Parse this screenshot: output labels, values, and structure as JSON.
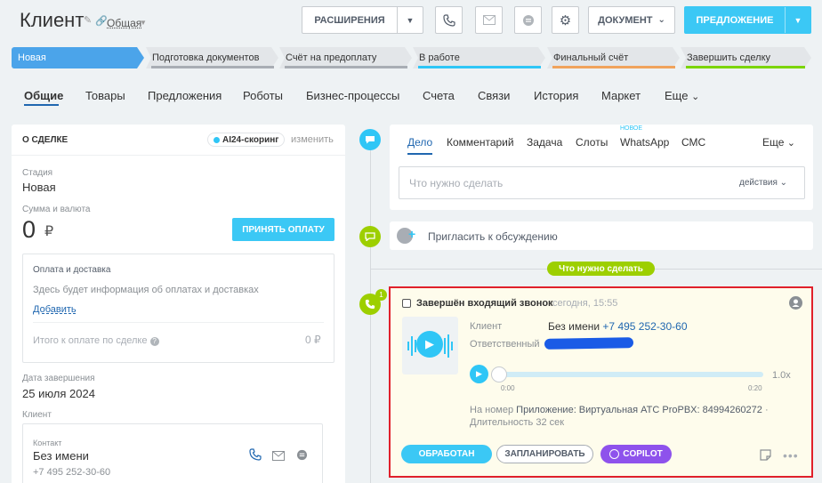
{
  "header": {
    "title": "Клиент",
    "category": "Общая",
    "extensions_label": "РАСШИРЕНИЯ",
    "document_label": "ДОКУМЕНТ",
    "proposal_label": "ПРЕДЛОЖЕНИЕ"
  },
  "stages": [
    {
      "label": "Новая",
      "color": "#4ba4ea"
    },
    {
      "label": "Подготовка документов",
      "color": "#a8adb4"
    },
    {
      "label": "Счёт на предоплату",
      "color": "#a8adb4"
    },
    {
      "label": "В работе",
      "color": "#2fc6f6"
    },
    {
      "label": "Финальный счёт",
      "color": "#f0a35c"
    },
    {
      "label": "Завершить сделку",
      "color": "#7bd500"
    }
  ],
  "tabs": [
    "Общие",
    "Товары",
    "Предложения",
    "Роботы",
    "Бизнес-процессы",
    "Счета",
    "Связи",
    "История",
    "Маркет",
    "Еще"
  ],
  "deal": {
    "section_title": "О СДЕЛКЕ",
    "ai_label": "AI24-скоринг",
    "change_label": "изменить",
    "stage_label": "Стадия",
    "stage_value": "Новая",
    "amount_label": "Сумма и валюта",
    "amount_value": "0",
    "currency": "₽",
    "pay_button": "ПРИНЯТЬ ОПЛАТУ",
    "payment": {
      "title": "Оплата и доставка",
      "info": "Здесь будет информация об оплатах и доставках",
      "add_link": "Добавить",
      "total_label": "Итого к оплате по сделке",
      "total_value": "0 ₽"
    },
    "close_date_label": "Дата завершения",
    "close_date_value": "25 июля 2024",
    "client_label": "Клиент",
    "contact": {
      "label": "Контакт",
      "name": "Без имени",
      "phone": "+7 495 252-30-60"
    }
  },
  "timeline": {
    "tabs": [
      "Дело",
      "Комментарий",
      "Задача",
      "Слоты",
      "WhatsApp",
      "СМС",
      "Еще"
    ],
    "new_label": "НОВОЕ",
    "input_placeholder": "Что нужно сделать",
    "actions_label": "действия",
    "invite_label": "Пригласить к обсуждению",
    "todo_label": "Что нужно сделать",
    "badge_count": "1",
    "call": {
      "title": "Завершён входящий звонок",
      "time": "сегодня, 15:55",
      "client_label": "Клиент",
      "client_name": "Без имени",
      "client_phone": "+7 495 252-30-60",
      "responsible_label": "Ответственный",
      "speed": "1.0x",
      "time_start": "0:00",
      "time_end": "0:20",
      "meta_prefix": "На номер",
      "meta_value": "Приложение: Виртуальная АТС ProPBX: 84994260272",
      "meta_duration": "· Длительность 32 сек",
      "btn_done": "ОБРАБОТАН",
      "btn_plan": "ЗАПЛАНИРОВАТЬ",
      "btn_copilot": "COPILOT"
    }
  }
}
